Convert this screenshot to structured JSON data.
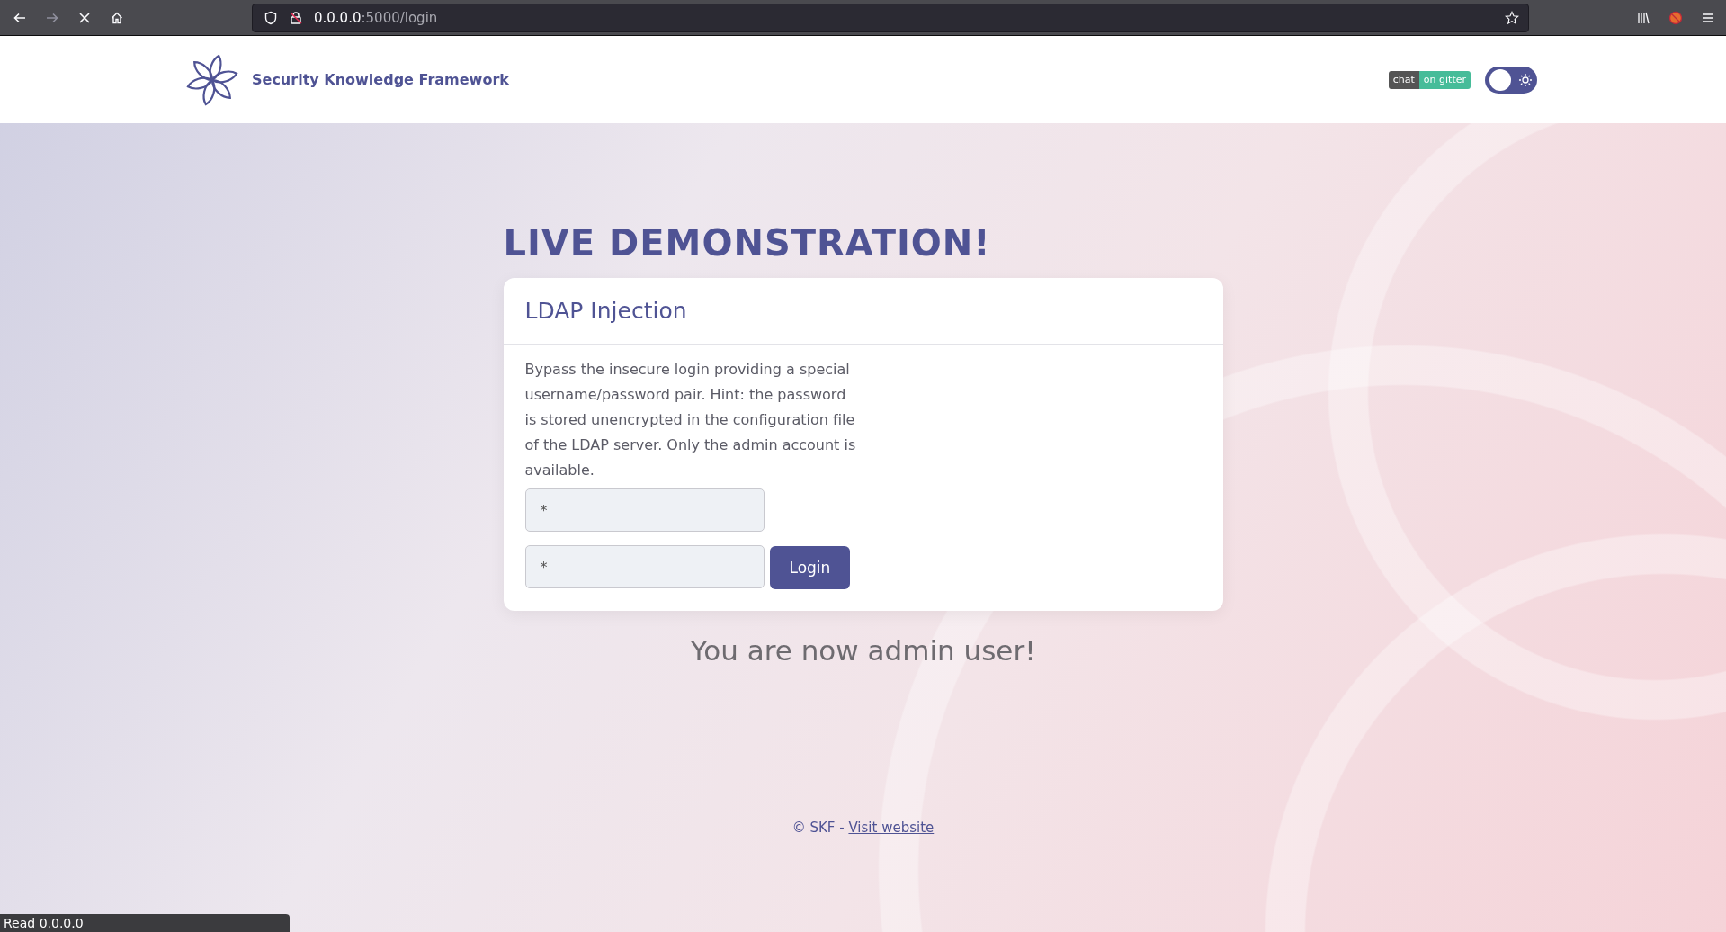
{
  "browser": {
    "url_host": "0.0.0.0",
    "url_path": ":5000/login",
    "status_text": "Read 0.0.0.0"
  },
  "header": {
    "brand": "Security Knowledge Framework",
    "chat_badge": {
      "left": "chat",
      "right": "on gitter"
    },
    "theme_toggle": {
      "on": false
    }
  },
  "headline": "LIVE DEMONSTRATION!",
  "card": {
    "title": "LDAP Injection",
    "description": "Bypass the insecure login providing a special username/password pair. Hint: the password is stored unencrypted in the configuration file of the LDAP server. Only the admin account is available.",
    "fields": [
      {
        "value": "*"
      },
      {
        "value": "*"
      }
    ],
    "button": "Login"
  },
  "result": "You are now admin user!",
  "footer": {
    "text": "© SKF -",
    "link": "Visit website"
  }
}
